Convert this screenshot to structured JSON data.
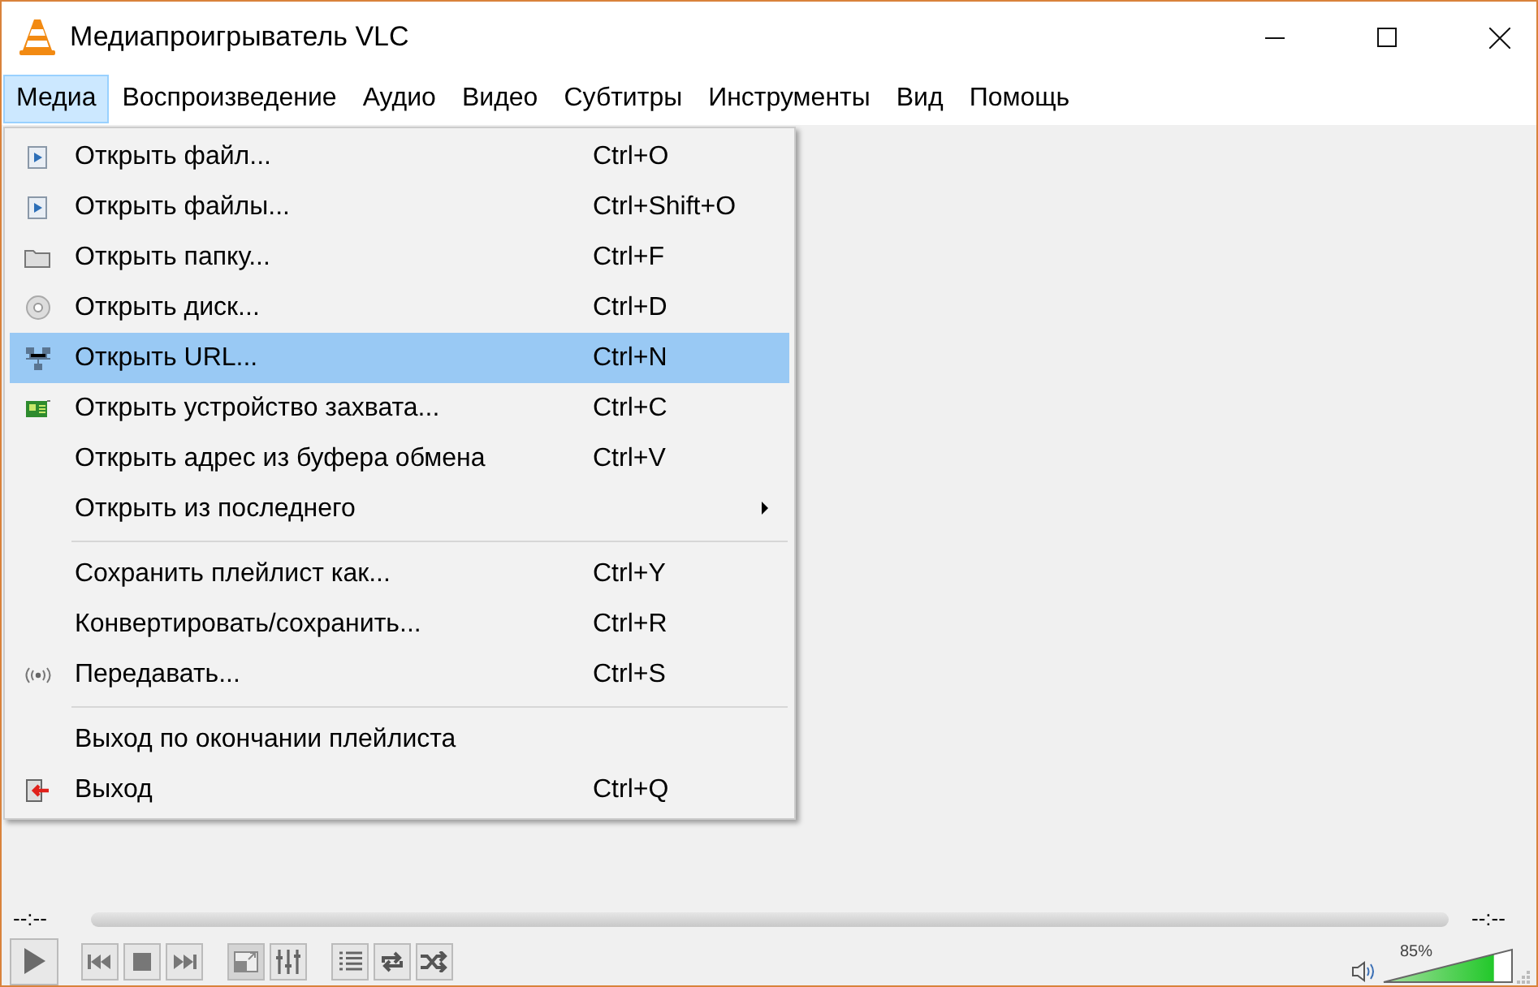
{
  "window": {
    "title": "Медиапроигрыватель VLC"
  },
  "menubar": [
    {
      "label": "Медиа",
      "selected": true
    },
    {
      "label": "Воспроизведение",
      "selected": false
    },
    {
      "label": "Аудио",
      "selected": false
    },
    {
      "label": "Видео",
      "selected": false
    },
    {
      "label": "Субтитры",
      "selected": false
    },
    {
      "label": "Инструменты",
      "selected": false
    },
    {
      "label": "Вид",
      "selected": false
    },
    {
      "label": "Помощь",
      "selected": false
    }
  ],
  "menu": {
    "groups": [
      [
        {
          "label": "Открыть файл...",
          "shortcut": "Ctrl+O",
          "selected": false
        },
        {
          "label": "Открыть файлы...",
          "shortcut": "Ctrl+Shift+O",
          "selected": false
        },
        {
          "label": "Открыть папку...",
          "shortcut": "Ctrl+F",
          "selected": false
        },
        {
          "label": "Открыть диск...",
          "shortcut": "Ctrl+D",
          "selected": false
        },
        {
          "label": "Открыть URL...",
          "shortcut": "Ctrl+N",
          "selected": true
        },
        {
          "label": "Открыть устройство захвата...",
          "shortcut": "Ctrl+C",
          "selected": false
        },
        {
          "label": "Открыть адрес из буфера обмена",
          "shortcut": "Ctrl+V",
          "selected": false
        },
        {
          "label": "Открыть из последнего",
          "selected": false,
          "has_submenu": true
        }
      ],
      [
        {
          "label": "Сохранить плейлист как...",
          "shortcut": "Ctrl+Y",
          "selected": false
        },
        {
          "label": "Конвертировать/сохранить...",
          "shortcut": "Ctrl+R",
          "selected": false
        },
        {
          "label": "Передавать...",
          "shortcut": "Ctrl+S",
          "selected": false
        }
      ],
      [
        {
          "label": "Выход по окончании плейлиста",
          "selected": false
        },
        {
          "label": "Выход",
          "shortcut": "Ctrl+Q",
          "selected": false
        }
      ]
    ]
  },
  "player": {
    "elapsed": "--:--",
    "remaining": "--:--",
    "volume": {
      "reading": "85%",
      "level": 0.85
    }
  }
}
